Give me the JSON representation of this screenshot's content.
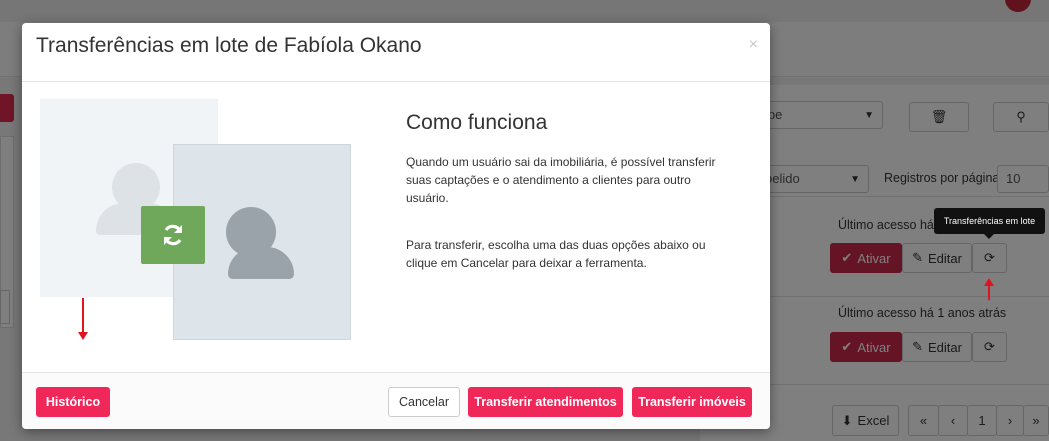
{
  "background": {
    "filter_select": "ipe",
    "sort_select": "pelido",
    "per_page_label": "Registros por página",
    "per_page_value": "10",
    "rows": [
      {
        "last_access": "Último acesso há",
        "activate": "Ativar",
        "edit": "Editar"
      },
      {
        "last_access": "Último acesso há 1 anos atrás",
        "activate": "Ativar",
        "edit": "Editar"
      }
    ],
    "excel": "Excel",
    "pagination": {
      "first": "«",
      "prev": "‹",
      "current": "1",
      "next": "›",
      "last": "»"
    },
    "tooltip": "Transferências em lote"
  },
  "modal": {
    "title": "Transferências em lote de Fabíola Okano",
    "close": "×",
    "heading": "Como funciona",
    "paragraph1": "Quando um usuário sai da imobiliária, é possível transferir suas captações e o atendimento a clientes para outro usuário.",
    "paragraph2": "Para transferir, escolha uma das duas opções abaixo ou clique em Cancelar para deixar a ferramenta.",
    "buttons": {
      "history": "Histórico",
      "cancel": "Cancelar",
      "transfer_clients": "Transferir atendimentos",
      "transfer_properties": "Transferir imóveis"
    }
  },
  "colors": {
    "primary": "#f0285a",
    "accent_green": "#6fa85b",
    "bg_red": "#c9284a",
    "annotation_arrow": "#e0141f"
  }
}
